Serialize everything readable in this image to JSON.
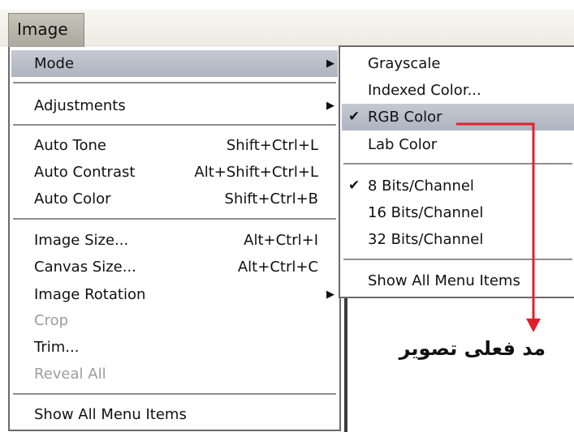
{
  "menubar": {
    "title": "Image"
  },
  "menu": {
    "items": [
      {
        "label": "Mode",
        "shortcut": "",
        "submenu": true,
        "highlighted": true,
        "disabled": false
      },
      {
        "label": "Adjustments",
        "shortcut": "",
        "submenu": true,
        "highlighted": false,
        "disabled": false
      },
      {
        "label": "Auto Tone",
        "shortcut": "Shift+Ctrl+L",
        "submenu": false,
        "highlighted": false,
        "disabled": false
      },
      {
        "label": "Auto Contrast",
        "shortcut": "Alt+Shift+Ctrl+L",
        "submenu": false,
        "highlighted": false,
        "disabled": false
      },
      {
        "label": "Auto Color",
        "shortcut": "Shift+Ctrl+B",
        "submenu": false,
        "highlighted": false,
        "disabled": false
      },
      {
        "label": "Image Size...",
        "shortcut": "Alt+Ctrl+I",
        "submenu": false,
        "highlighted": false,
        "disabled": false
      },
      {
        "label": "Canvas Size...",
        "shortcut": "Alt+Ctrl+C",
        "submenu": false,
        "highlighted": false,
        "disabled": false
      },
      {
        "label": "Image Rotation",
        "shortcut": "",
        "submenu": true,
        "highlighted": false,
        "disabled": false
      },
      {
        "label": "Crop",
        "shortcut": "",
        "submenu": false,
        "highlighted": false,
        "disabled": true
      },
      {
        "label": "Trim...",
        "shortcut": "",
        "submenu": false,
        "highlighted": false,
        "disabled": false
      },
      {
        "label": "Reveal All",
        "shortcut": "",
        "submenu": false,
        "highlighted": false,
        "disabled": true
      },
      {
        "label": "Show All Menu Items",
        "shortcut": "",
        "submenu": false,
        "highlighted": false,
        "disabled": false
      }
    ]
  },
  "submenu": {
    "items": [
      {
        "label": "Grayscale",
        "checked": false,
        "highlighted": false
      },
      {
        "label": "Indexed Color...",
        "checked": false,
        "highlighted": false
      },
      {
        "label": "RGB Color",
        "checked": true,
        "highlighted": true
      },
      {
        "label": "Lab Color",
        "checked": false,
        "highlighted": false
      },
      {
        "label": "8 Bits/Channel",
        "checked": true,
        "highlighted": false
      },
      {
        "label": "16 Bits/Channel",
        "checked": false,
        "highlighted": false
      },
      {
        "label": "32 Bits/Channel",
        "checked": false,
        "highlighted": false
      },
      {
        "label": "Show All Menu Items",
        "checked": false,
        "highlighted": false
      }
    ]
  },
  "glyphs": {
    "arrow": "▶",
    "check": "✔"
  },
  "annotation": {
    "caption": "مد فعلی تصویر",
    "color": "#e0212b"
  },
  "colors": {
    "highlight": "#b8bdc8",
    "menu_border": "#6a6a6a",
    "disabled_text": "#9d9d9d"
  }
}
